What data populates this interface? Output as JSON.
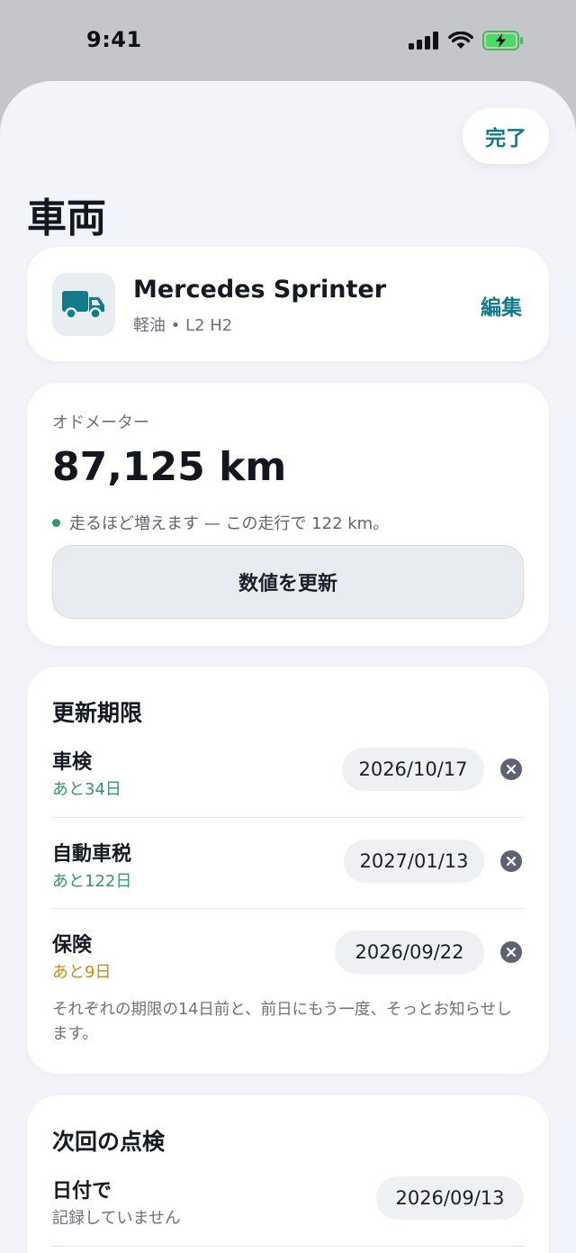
{
  "status_bar": {
    "time": "9:41"
  },
  "header": {
    "done_label": "完了",
    "title": "車両"
  },
  "vehicle": {
    "name": "Mercedes Sprinter",
    "subtitle": "軽油 • L2 H2",
    "edit_label": "編集",
    "icon": "truck-icon"
  },
  "odometer": {
    "label": "オドメーター",
    "value": "87,125 km",
    "note": "走るほど増えます — この走行で 122 km。",
    "update_label": "数値を更新"
  },
  "deadlines": {
    "title": "更新期限",
    "items": [
      {
        "label": "車検",
        "remaining": "あと34日",
        "date": "2026/10/17",
        "status": "ok"
      },
      {
        "label": "自動車税",
        "remaining": "あと122日",
        "date": "2027/01/13",
        "status": "ok"
      },
      {
        "label": "保険",
        "remaining": "あと9日",
        "date": "2026/09/22",
        "status": "soon"
      }
    ],
    "note": "それぞれの期限の14日前と、前日にもう一度、そっとお知らせします。"
  },
  "next_inspection": {
    "title": "次回の点検",
    "by_date_label": "日付で",
    "by_date_sub": "記録していません",
    "by_date_value": "2026/09/13"
  },
  "colors": {
    "accent": "#137a89",
    "ok": "#2f9a63",
    "soon": "#c98a18"
  }
}
